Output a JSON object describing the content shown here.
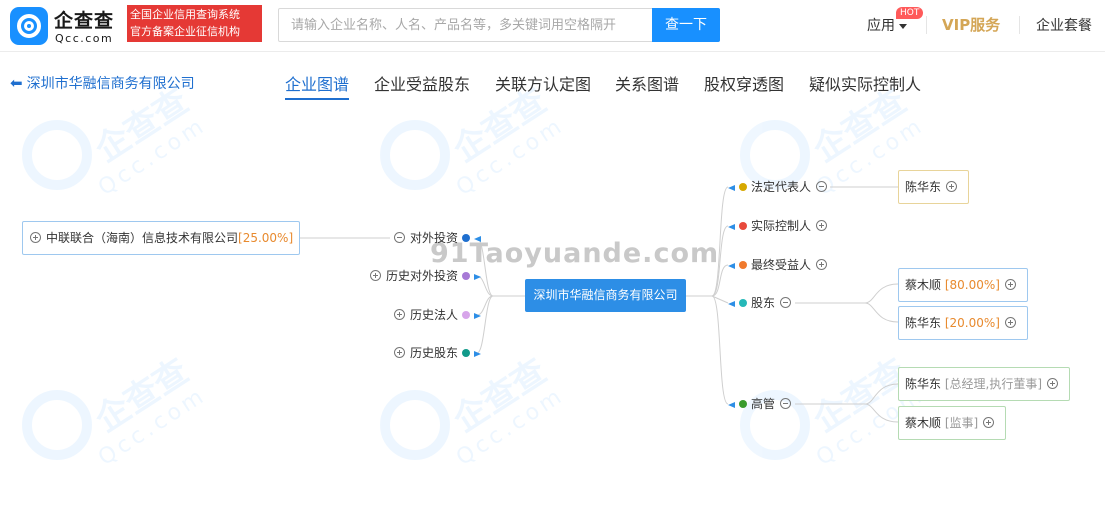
{
  "header": {
    "logo_cn": "企查查",
    "logo_en": "Qcc.com",
    "cert_line1": "全国企业信用查询系统",
    "cert_line2": "官方备案企业征信机构",
    "search_placeholder": "请输入企业名称、人名、产品名等，多关键词用空格隔开",
    "search_button": "查一下",
    "nav_app": "应用",
    "nav_app_badge": "HOT",
    "nav_vip": "VIP服务",
    "nav_package": "企业套餐"
  },
  "subnav": {
    "back_label": "深圳市华融信商务有限公司",
    "tabs": [
      "企业图谱",
      "企业受益股东",
      "关联方认定图",
      "关系图谱",
      "股权穿透图",
      "疑似实际控制人"
    ],
    "active_tab": "企业图谱"
  },
  "watermark": {
    "brand_cn": "企查查",
    "brand_en": "Qcc.com",
    "site": "91Taoyuande.com"
  },
  "graph": {
    "center": "深圳市华融信商务有限公司",
    "left_branches": [
      {
        "label": "对外投资",
        "color": "#1f6fcf",
        "expanded": true
      },
      {
        "label": "历史对外投资",
        "color": "#a77ad6",
        "expanded": false
      },
      {
        "label": "历史法人",
        "color": "#d7a5ea",
        "expanded": false
      },
      {
        "label": "历史股东",
        "color": "#119a8a",
        "expanded": false
      }
    ],
    "investment": {
      "name": "中联联合（海南）信息技术有限公司",
      "pct": "[25.00%]"
    },
    "right_branches": [
      {
        "label": "法定代表人",
        "color": "#d6a800",
        "expanded": true
      },
      {
        "label": "实际控制人",
        "color": "#e84a3c",
        "expanded": false
      },
      {
        "label": "最终受益人",
        "color": "#f07a2e",
        "expanded": false
      },
      {
        "label": "股东",
        "color": "#25b8b8",
        "expanded": true
      },
      {
        "label": "高管",
        "color": "#3a9b2d",
        "expanded": true
      }
    ],
    "legal_rep": {
      "name": "陈华东"
    },
    "shareholders": [
      {
        "name": "蔡木顺",
        "pct": "[80.00%]"
      },
      {
        "name": "陈华东",
        "pct": "[20.00%]"
      }
    ],
    "executives": [
      {
        "name": "陈华东",
        "role": "[总经理,执行董事]"
      },
      {
        "name": "蔡木顺",
        "role": "[监事]"
      }
    ]
  }
}
